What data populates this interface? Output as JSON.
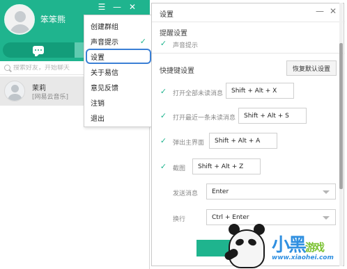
{
  "left_panel": {
    "username": "笨笨熊",
    "search_placeholder": "搜索好友，开始聊天",
    "contact": {
      "name": "茉莉",
      "status": "[网易云音乐]"
    }
  },
  "menu": {
    "items": [
      {
        "label": "创建群组"
      },
      {
        "label": "声音提示",
        "checked": true
      },
      {
        "label": "设置",
        "selected": true
      },
      {
        "label": "关于易信"
      },
      {
        "label": "意见反馈"
      },
      {
        "label": "注销"
      },
      {
        "label": "退出"
      }
    ]
  },
  "settings": {
    "title": "设置",
    "reminder": {
      "section_title": "提醒设置",
      "sound_label": "声音提示",
      "sound_checked": true
    },
    "shortcuts": {
      "section_title": "快捷键设置",
      "reset_label": "恢复默认设置",
      "rows": [
        {
          "label": "打开全部未读消息",
          "key": "Shift + Alt + X",
          "checked": true
        },
        {
          "label": "打开最近一条未读消息",
          "key": "Shift + Alt + S",
          "checked": true
        },
        {
          "label": "弹出主界面",
          "key": "Shift + Alt + A",
          "checked": true
        },
        {
          "label": "截图",
          "key": "Shift + Alt + Z",
          "checked": true
        }
      ],
      "send_label": "发送消息",
      "send_value": "Enter",
      "newline_label": "换行",
      "newline_value": "Ctrl + Enter"
    }
  },
  "watermark": {
    "url": "www.xiaohei.com"
  },
  "colors": {
    "accent": "#1fb48e",
    "selection": "#3a7fd5"
  },
  "icons": [
    "chat-icon",
    "search-icon",
    "check-icon",
    "close-icon",
    "minimize-icon",
    "caret-down-icon"
  ]
}
